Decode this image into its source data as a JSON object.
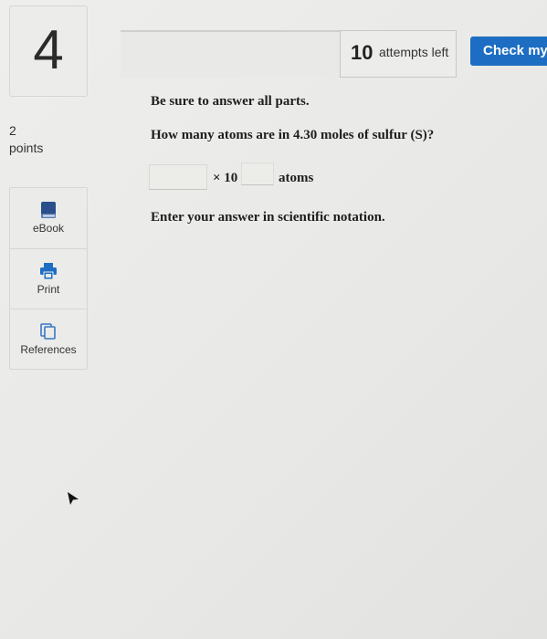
{
  "question": {
    "number": "4",
    "points_value": "2",
    "points_label": "points"
  },
  "tools": [
    {
      "label": "eBook",
      "icon": "ebook-icon"
    },
    {
      "label": "Print",
      "icon": "printer-icon"
    },
    {
      "label": "References",
      "icon": "references-icon"
    }
  ],
  "header": {
    "attempts_count": "10",
    "attempts_label": "attempts left",
    "check_button_label": "Check my"
  },
  "content": {
    "instructions": "Be sure to answer all parts.",
    "question_text": "How many atoms are in 4.30 moles of sulfur (S)?",
    "answer_value": "",
    "times_ten_label": "× 10",
    "exponent_value": "",
    "unit_label": "atoms",
    "note": "Enter your answer in scientific notation."
  },
  "colors": {
    "accent": "#1d6ec2",
    "ebook_icon": "#2a4f8a",
    "print_icon": "#1d6ec2",
    "references_icon": "#3a78c6"
  }
}
